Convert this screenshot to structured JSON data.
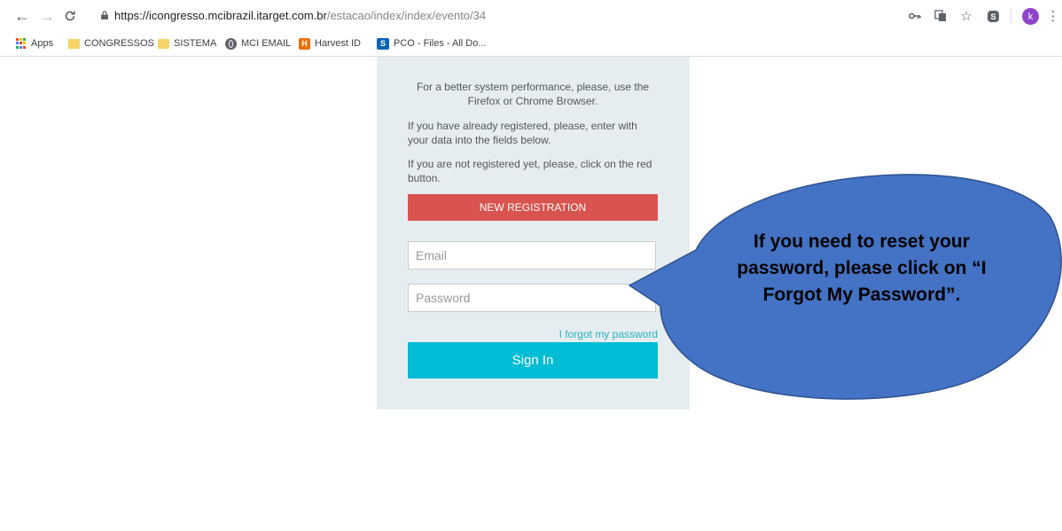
{
  "browser": {
    "url_host": "https://icongresso.mcibrazil.itarget.com.br",
    "url_path": "/estacao/index/index/evento/34",
    "profile_initial": "k"
  },
  "bookmarks": [
    {
      "label": "Apps",
      "icon": "apps-grid-icon"
    },
    {
      "label": "CONGRESSOS",
      "icon": "folder-icon"
    },
    {
      "label": "SISTEMA",
      "icon": "folder-icon"
    },
    {
      "label": "MCI EMAIL",
      "icon": "globe-icon"
    },
    {
      "label": "Harvest ID",
      "icon": "harvest-icon"
    },
    {
      "label": "PCO - Files - All Do...",
      "icon": "sharepoint-icon"
    }
  ],
  "login": {
    "browser_notice": "For a better system performance, please, use the Firefox or Chrome Browser.",
    "registered_notice": "If you have already registered, please, enter with your data into the fields below.",
    "not_registered_notice": "If you are not registered yet, please, click on the red button.",
    "new_registration_label": "NEW REGISTRATION",
    "email_placeholder": "Email",
    "password_placeholder": "Password",
    "forgot_label": "I forgot my password",
    "sign_in_label": "Sign In"
  },
  "callout": {
    "text": "If you need to reset your password, please click on “I Forgot My Password”.",
    "fill_color": "#4472c4",
    "border_color": "#2f528f"
  },
  "colors": {
    "panel_bg": "#e6edf1",
    "new_registration_bg": "#d9534f",
    "sign_in_bg": "#00bcd4",
    "forgot_link": "#29b3c2"
  }
}
